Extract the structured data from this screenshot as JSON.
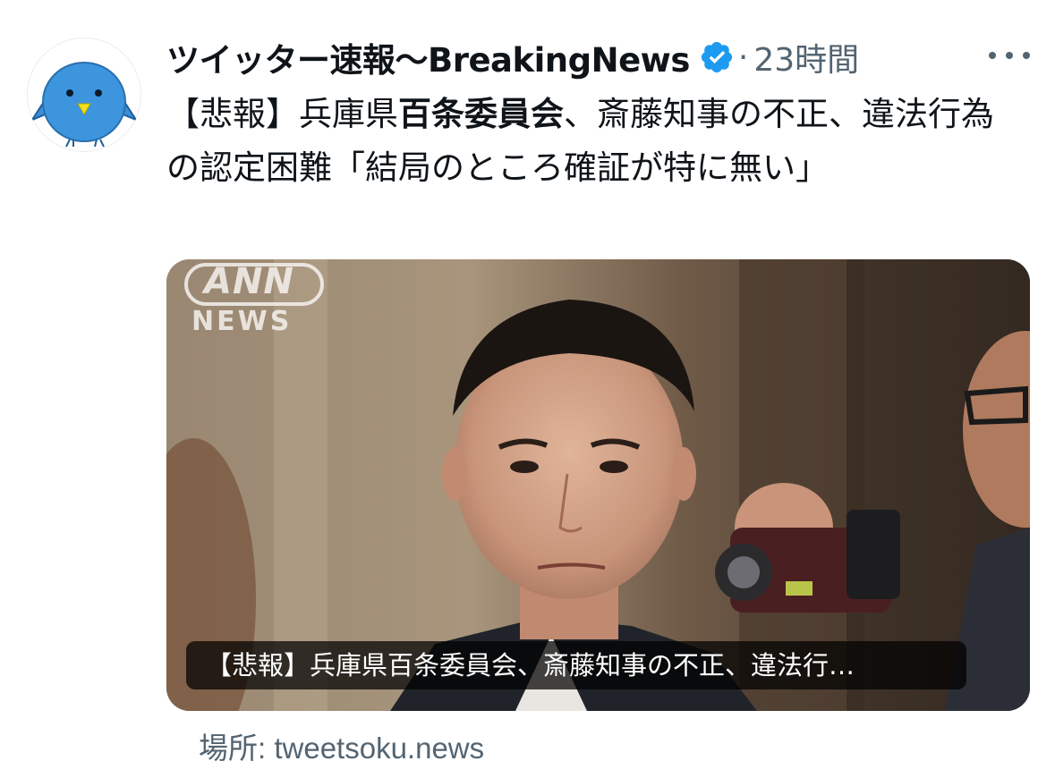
{
  "tweet": {
    "author_name": "ツイッター速報〜BreakingNews",
    "verified": true,
    "separator": "·",
    "time": "23時間",
    "text_part1": "【悲報】兵庫県",
    "text_bold": "百条委員会",
    "text_part2": "、斎藤知事の不正、違法行為の認定困難「結局のところ確証が特に無い」",
    "media": {
      "caption": "【悲報】兵庫県百条委員会、斎藤知事の不正、違法行…",
      "watermark_top": "ANN",
      "watermark_bottom": "NEWS"
    },
    "source_label": "場所: tweetsoku.news"
  },
  "icons": {
    "verified": "verified-badge-icon",
    "more": "more-options-icon",
    "avatar": "blue-bird-avatar"
  },
  "colors": {
    "verified_blue": "#1d9bf0",
    "secondary_text": "#536471",
    "primary_text": "#0f1419"
  }
}
